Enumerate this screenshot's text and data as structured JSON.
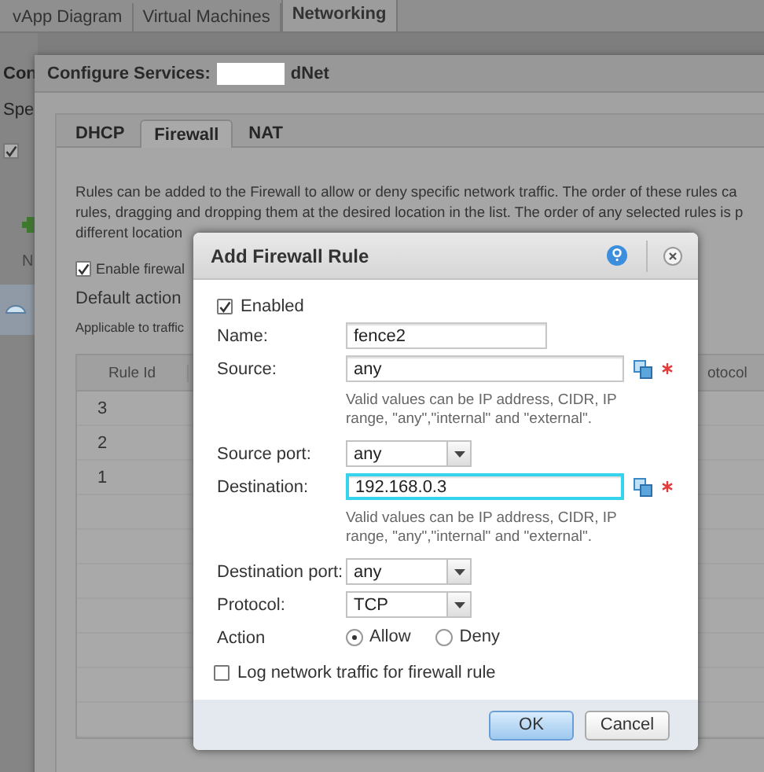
{
  "app_tabs": [
    {
      "label": "vApp Diagram",
      "selected": false
    },
    {
      "label": "Virtual Machines",
      "selected": false
    },
    {
      "label": "Networking",
      "selected": true
    }
  ],
  "background_panel": {
    "title": "Con",
    "subtitle": "Spe",
    "checkbox_checked": true,
    "column_header": "N"
  },
  "configure_dialog": {
    "title": "Configure Services:",
    "title_suffix": "dNet",
    "tabs": [
      {
        "label": "DHCP",
        "selected": false
      },
      {
        "label": "Firewall",
        "selected": true
      },
      {
        "label": "NAT",
        "selected": false
      }
    ],
    "description": [
      "Rules can be added to the Firewall to allow or deny specific network traffic. The order of these rules ca",
      "rules, dragging and dropping them at the desired location in the list. The order of any selected rules is p",
      "different location"
    ],
    "enable_firewall": {
      "label": "Enable firewal",
      "checked": true
    },
    "default_action_label": "Default action",
    "applicable_label": "Applicable to traffic",
    "table": {
      "columns": [
        "Rule Id",
        "otocol"
      ],
      "rows": [
        "3",
        "2",
        "1"
      ]
    }
  },
  "modal": {
    "title": "Add Firewall Rule",
    "enabled": {
      "label": "Enabled",
      "checked": true
    },
    "fields": [
      {
        "kind": "text",
        "label": "Name:",
        "value": "fence2"
      },
      {
        "kind": "address",
        "label": "Source:",
        "value": "any",
        "focused": false,
        "hint": "Valid values can be IP address, CIDR, IP range, \"any\",\"internal\" and \"external\"."
      },
      {
        "kind": "select",
        "label": "Source port:",
        "value": "any"
      },
      {
        "kind": "address",
        "label": "Destination:",
        "value": "192.168.0.3",
        "focused": true,
        "hint": "Valid values can be IP address, CIDR, IP range, \"any\",\"internal\" and \"external\"."
      },
      {
        "kind": "select",
        "label": "Destination port:",
        "value": "any"
      },
      {
        "kind": "select",
        "label": "Protocol:",
        "value": "TCP"
      },
      {
        "kind": "radio",
        "label": "Action",
        "options": [
          {
            "label": "Allow",
            "selected": true
          },
          {
            "label": "Deny",
            "selected": false
          }
        ]
      }
    ],
    "log": {
      "label": "Log network traffic for firewall rule",
      "checked": false
    },
    "buttons": [
      {
        "label": "OK",
        "primary": true
      },
      {
        "label": "Cancel",
        "primary": false
      }
    ]
  }
}
